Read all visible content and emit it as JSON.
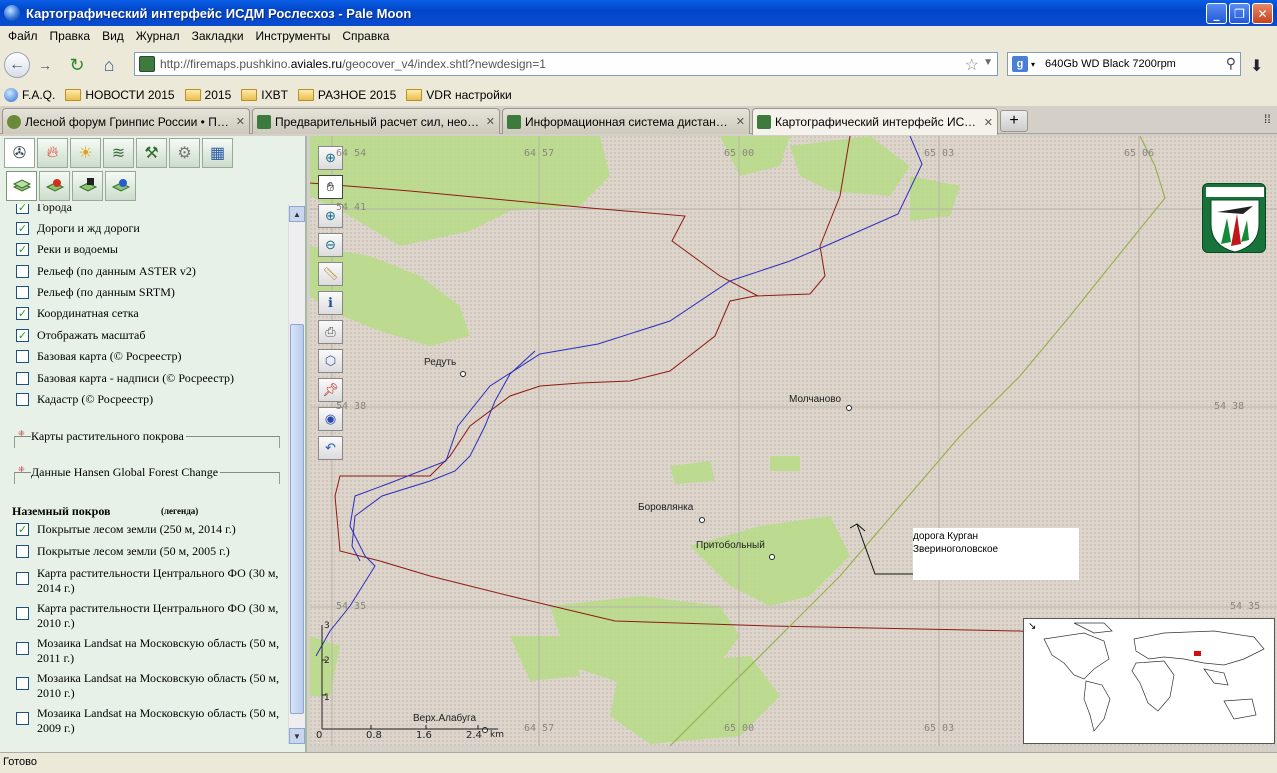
{
  "window": {
    "title": "Картографический интерфейс ИСДМ Рослесхоз - Pale Moon",
    "minimize": "_",
    "maximize": "❐",
    "close": "✕"
  },
  "menu": [
    "Файл",
    "Правка",
    "Вид",
    "Журнал",
    "Закладки",
    "Инструменты",
    "Справка"
  ],
  "nav": {
    "url_pre": "http://firemaps.pushkino.",
    "url_host": "aviales.ru",
    "url_post": "/geocover_v4/index.shtl?newdesign=1",
    "search_text": "640Gb WD Black 7200rpm"
  },
  "bookmarks": [
    "F.A.Q.",
    "НОВОСТИ  2015",
    "2015",
    "IXBT",
    "РАЗНОЕ 2015",
    "VDR настройки"
  ],
  "tabs": [
    {
      "label": "Лесной форум Гринпис России • Просм..."
    },
    {
      "label": "Предварительный расчет сил, необхо..."
    },
    {
      "label": "Информационная система дистанцион..."
    },
    {
      "label": "Картографический интерфейс ИСДМ Р..."
    }
  ],
  "layers": {
    "cut_top": "Города",
    "items": [
      {
        "label": "Дороги и жд дороги",
        "checked": true
      },
      {
        "label": "Реки и водоемы",
        "checked": true
      },
      {
        "label": "Рельеф (по данным ASTER v2)",
        "checked": false
      },
      {
        "label": "Рельеф (по данным SRTM)",
        "checked": false
      },
      {
        "label": "Координатная сетка",
        "checked": true
      },
      {
        "label": "Отображать масштаб",
        "checked": true
      },
      {
        "label": "Базовая карта (© Росреестр)",
        "checked": false
      },
      {
        "label": "Базовая карта - надписи (© Росреестр)",
        "checked": false
      },
      {
        "label": "Кадастр (© Росреестр)",
        "checked": false
      }
    ],
    "groups": [
      "Карты растительного покрова",
      "Данные Hansen Global Forest Change"
    ],
    "landcover_title": "Наземный покров",
    "landcover_legend": "(легенда)",
    "landcover": [
      {
        "label": "Покрытые лесом земли (250 м, 2014 г.)",
        "checked": true
      },
      {
        "label": "Покрытые лесом земли (50 м, 2005 г.)",
        "checked": false
      },
      {
        "label": "Карта растительности Центрального ФО (30 м, 2014 г.)",
        "checked": false
      },
      {
        "label": "Карта растительности Центрального ФО (30 м, 2010 г.)",
        "checked": false
      },
      {
        "label": "Мозаика Landsat на Московскую область (50 м, 2011 г.)",
        "checked": false
      },
      {
        "label": "Мозаика Landsat на Московскую область (50 м, 2010 г.)",
        "checked": false
      },
      {
        "label": "Мозаика Landsat на Московскую область (50 м, 2009 г.)",
        "checked": false
      }
    ]
  },
  "map": {
    "places": [
      "Редуть",
      "Молчаново",
      "Боровлянка",
      "Притобольный",
      "Верх.Алабуга"
    ],
    "coords": {
      "lon": [
        "64 54",
        "64 57",
        "65 00",
        "65 03",
        "65 06"
      ],
      "lat": [
        "54 41",
        "54 38",
        "54 35"
      ]
    },
    "annotation": [
      "дорога Курган",
      "Звериноголовское"
    ],
    "scale": {
      "ticks": [
        "0",
        "0.8",
        "1.6",
        "2.4"
      ],
      "unit": "km",
      "vticks": [
        "3",
        "2",
        "1"
      ]
    }
  },
  "status": "Готово"
}
